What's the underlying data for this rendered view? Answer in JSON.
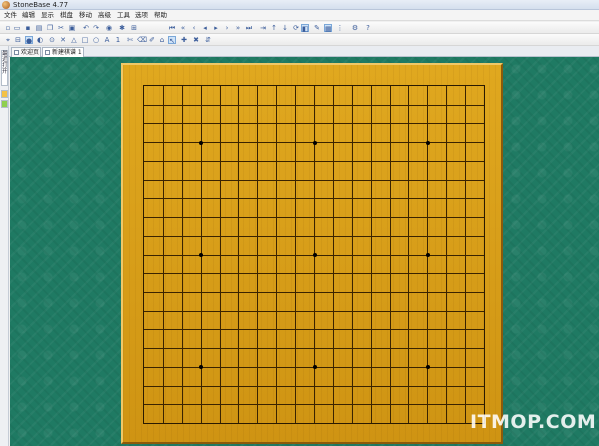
{
  "window": {
    "title": "StoneBase 4.77"
  },
  "menu": [
    "文件",
    "编辑",
    "显示",
    "棋盘",
    "移动",
    "高级",
    "工具",
    "选项",
    "帮助"
  ],
  "toolbar1": [
    "new-icon",
    "open-icon",
    "save-icon",
    "print-icon",
    "copy-icon",
    "cut-icon",
    "paste-icon",
    "undo-icon",
    "redo-icon",
    "search-icon",
    "first-move-icon",
    "prev-10-icon",
    "prev-5-icon",
    "prev-move-icon",
    "next-move-icon",
    "next-5-icon",
    "next-10-icon",
    "last-move-icon",
    "goto-icon",
    "branch-prev-icon",
    "branch-next-icon",
    "rotate-icon",
    "flip-icon",
    "grid-icon",
    "comment-icon",
    "settings-icon",
    "help-icon"
  ],
  "toolbar2": [
    "select-icon",
    "black-stone-icon",
    "white-stone-icon",
    "alternate-icon",
    "triangle-icon",
    "square-icon",
    "circle-icon",
    "letter-icon",
    "number-icon",
    "eraser-icon",
    "cross-icon",
    "scissors-icon",
    "edit-icon",
    "mark-icon",
    "delete-icon"
  ],
  "tabs": [
    {
      "label": "欢迎页",
      "active": false
    },
    {
      "label": "新建棋谱 1",
      "active": true
    }
  ],
  "sidebar": {
    "vertical_label": "最近打开"
  },
  "board": {
    "size": 19,
    "star_points": [
      [
        3,
        3
      ],
      [
        3,
        9
      ],
      [
        3,
        15
      ],
      [
        9,
        3
      ],
      [
        9,
        9
      ],
      [
        9,
        15
      ],
      [
        15,
        3
      ],
      [
        15,
        9
      ],
      [
        15,
        15
      ]
    ]
  },
  "colors": {
    "background": "#1f7a63",
    "board": "#d79f1a",
    "grid": "#3a2300"
  },
  "watermark": "ITMOP.COM"
}
